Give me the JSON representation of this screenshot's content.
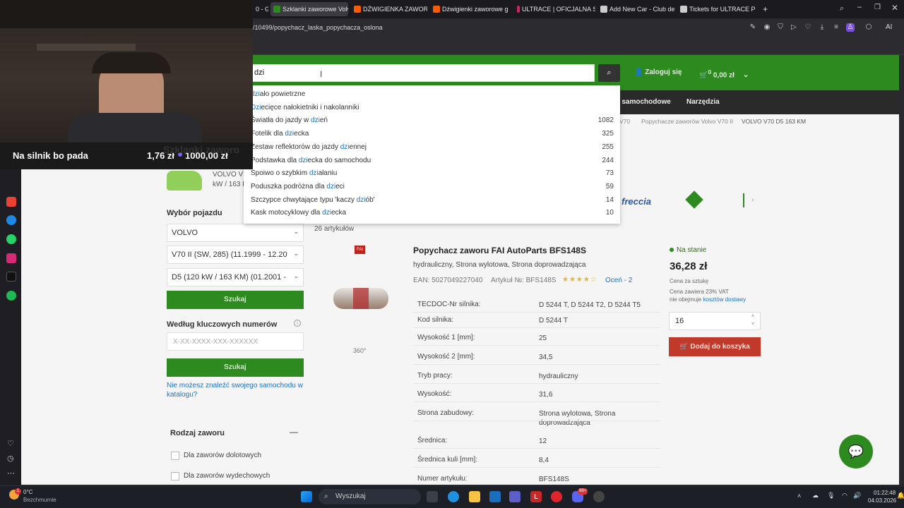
{
  "browser": {
    "tabs": [
      {
        "label": "0 - G",
        "active": false,
        "icon": "web-icon"
      },
      {
        "label": "Szklanki zaworowe Volvo",
        "active": true,
        "icon": "green-site-icon"
      },
      {
        "label": "DŹWIGIENKA ZAWORU P",
        "active": false,
        "icon": "allegro-icon"
      },
      {
        "label": "Dźwigienki zaworowe gło",
        "active": false,
        "icon": "allegro-icon"
      },
      {
        "label": "ULTRACE | OFICJALNA STI",
        "active": false,
        "icon": "ultrace-icon"
      },
      {
        "label": "Add New Car - Club de UI",
        "active": false,
        "icon": "web-icon"
      },
      {
        "label": "Tickets for ULTRACE POLA",
        "active": false,
        "icon": "web-icon"
      }
    ],
    "new_tab": "+",
    "url": "/10499/popychacz_laska_popychacza_oslona",
    "ai_label": "AI"
  },
  "header": {
    "search_value": "dzi",
    "login": "Zaloguj się",
    "cart": "0,00 zł",
    "cart_count": "0"
  },
  "nav": {
    "item1": "a samochodowe",
    "item2": "Narzędzia"
  },
  "breadcrumbs": [
    "V70",
    "Popychacze zaworów Volvo V70 II",
    "VOLVO V70 D5 163 KM"
  ],
  "suggestions": [
    {
      "pre": "",
      "hl": "dzi",
      "post": "ało powietrzne",
      "count": ""
    },
    {
      "pre": "",
      "hl": "Dzi",
      "post": "ecięce nałokietniki i nakolanniki",
      "count": ""
    },
    {
      "pre": "Światła do jazdy w ",
      "hl": "dzi",
      "post": "eń",
      "count": "1082"
    },
    {
      "pre": "Fotelik dla ",
      "hl": "dzi",
      "post": "ecka",
      "count": "325"
    },
    {
      "pre": "Zestaw reflektorów do jazdy ",
      "hl": "dzi",
      "post": "ennej",
      "count": "255"
    },
    {
      "pre": "Podstawka dla ",
      "hl": "dzi",
      "post": "ecka do samochodu",
      "count": "244"
    },
    {
      "pre": "Spoiwo o szybkim ",
      "hl": "dzi",
      "post": "ałaniu",
      "count": "73"
    },
    {
      "pre": "Poduszka podróżna dla ",
      "hl": "dzi",
      "post": "eci",
      "count": "59"
    },
    {
      "pre": "Szczypce chwytające typu 'kaczy ",
      "hl": "dzi",
      "post": "ób'",
      "count": "14"
    },
    {
      "pre": "Kask motocyklowy dla ",
      "hl": "dzi",
      "post": "ecka",
      "count": "10"
    }
  ],
  "left": {
    "page_heading": "Szklanki zaworo",
    "car_line1": "VOLVO V7",
    "car_line2": "kW / 163 K",
    "vehicle_heading": "Wybór pojazdu",
    "select_make": "VOLVO",
    "select_model": "V70 II (SW, 285) (11.1999 - 12.20",
    "select_engine": "D5 (120 kW / 163 KM) (01.2001 -",
    "search_button": "Szukaj",
    "keywords_heading": "Według kluczowych numerów",
    "keywords_placeholder": "X-XX-XXXX-XXX-XXXXXX",
    "search_button2": "Szukaj",
    "not_found_link": "Nie możesz znaleźć swojego samochodu w katalogu?",
    "valve_type_heading": "Rodzaj zaworu",
    "valve_opt1": "Dla zaworów dolotowych",
    "valve_opt2": "Dla zaworów wydechowych"
  },
  "results": {
    "count": "26 artykułów",
    "brand_logo": "freccia"
  },
  "product": {
    "title": "Popychacz zaworu FAI AutoParts BFS148S",
    "subtitle": "hydrauliczny, Strona wylotowa, Strona doprowadzająca",
    "ean": "EAN: 5027049227040",
    "article": "Artykuł №: BFS148S",
    "rating_text": "Oceń - 2",
    "rating_stars": 4,
    "view360": "360°",
    "specs": [
      {
        "label": "TECDOC-Nr silnika:",
        "value": "D 5244 T, D 5244 T2, D 5244 T5"
      },
      {
        "label": "Kod silnika:",
        "value": "D 5244 T"
      },
      {
        "label": "Wysokość 1 [mm]:",
        "value": "25"
      },
      {
        "label": "Wysokość 2 [mm]:",
        "value": "34,5"
      },
      {
        "label": "Tryb pracy:",
        "value": "hydrauliczny"
      },
      {
        "label": "Wysokość:",
        "value": "31,6"
      },
      {
        "label": "Strona zabudowy:",
        "value": "Strona wylotowa, Strona doprowadzająca"
      },
      {
        "label": "Średnica:",
        "value": "12"
      },
      {
        "label": "Średnica kuli [mm]:",
        "value": "8,4"
      },
      {
        "label": "Numer artykułu:",
        "value": "BFS148S"
      }
    ],
    "stock": "Na stanie",
    "price": "36,28 zł",
    "price_unit": "Cena za sztukę",
    "vat_note": "Cena zawiera 23% VAT",
    "shipping_note": "nie obejmuje",
    "shipping_link": "kosztów dostawy",
    "quantity": "16",
    "add_to_cart": "Dodaj do koszyka"
  },
  "stream": {
    "banner_text": "Na silnik bo pada",
    "banner_amount1": "1,76 zł",
    "banner_amount2": "1000,00 zł",
    "banner_progress": 0.0018
  },
  "taskbar": {
    "weather_temp": "0°C",
    "weather_desc": "Bezchmurnie",
    "weather_badge": "1",
    "search_placeholder": "Wyszukaj",
    "time": "01:22:48",
    "date": "04.03.2026",
    "notif_badge": "99+"
  },
  "colors": {
    "site_green": "#2d8a1f",
    "link_blue": "#1a73c9",
    "cart_red": "#c0392b"
  }
}
